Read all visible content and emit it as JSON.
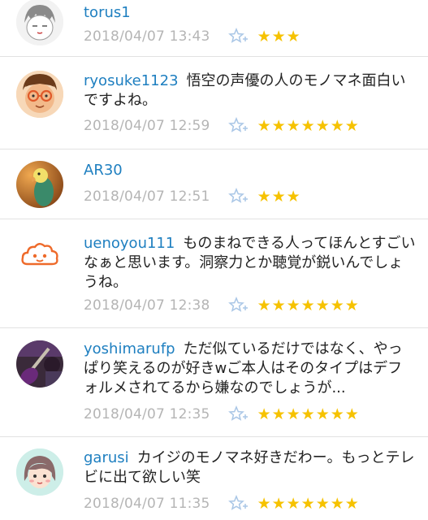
{
  "comments": [
    {
      "username": "torus1",
      "text": "",
      "timestamp": "2018/04/07 13:43",
      "stars": "★★★",
      "rating": 3,
      "avatar_icon": "sleepy-face-avatar-icon"
    },
    {
      "username": "ryosuke1123",
      "text": "悟空の声優の人のモノマネ面白いですよね。",
      "timestamp": "2018/04/07 12:59",
      "stars": "★★★★★★★",
      "rating": 7,
      "avatar_icon": "glasses-face-avatar-icon"
    },
    {
      "username": "AR30",
      "text": "",
      "timestamp": "2018/04/07 12:51",
      "stars": "★★★",
      "rating": 3,
      "avatar_icon": "parakeet-photo-avatar-icon"
    },
    {
      "username": "uenoyou111",
      "text": "ものまねできる人ってほんとすごいなぁと思います。洞察力とか聴覚が鋭いんでしょうね。",
      "timestamp": "2018/04/07 12:38",
      "stars": "★★★★★★★",
      "rating": 7,
      "avatar_icon": "cloud-face-avatar-icon"
    },
    {
      "username": "yoshimarufp",
      "text": "ただ似ているだけではなく、やっぱり笑えるのが好きwご本人はそのタイプはデフォルメされてるから嫌なのでしょうが...",
      "timestamp": "2018/04/07 12:35",
      "stars": "★★★★★★★",
      "rating": 7,
      "avatar_icon": "guitar-photo-avatar-icon"
    },
    {
      "username": "garusi",
      "text": "カイジのモノマネ好きだわー。もっとテレビに出て欲しい笑",
      "timestamp": "2018/04/07 11:35",
      "stars": "★★★★★★★",
      "rating": 7,
      "avatar_icon": "girl-face-avatar-icon"
    }
  ],
  "colors": {
    "username": "#1e7fc0",
    "timestamp": "#b5b5b5",
    "star": "#f6c200",
    "divider": "#e2e2e2",
    "favorite_icon": "#a9c6e6"
  },
  "icons": {
    "favorite": "star-plus-icon",
    "rating": "star-icon"
  }
}
